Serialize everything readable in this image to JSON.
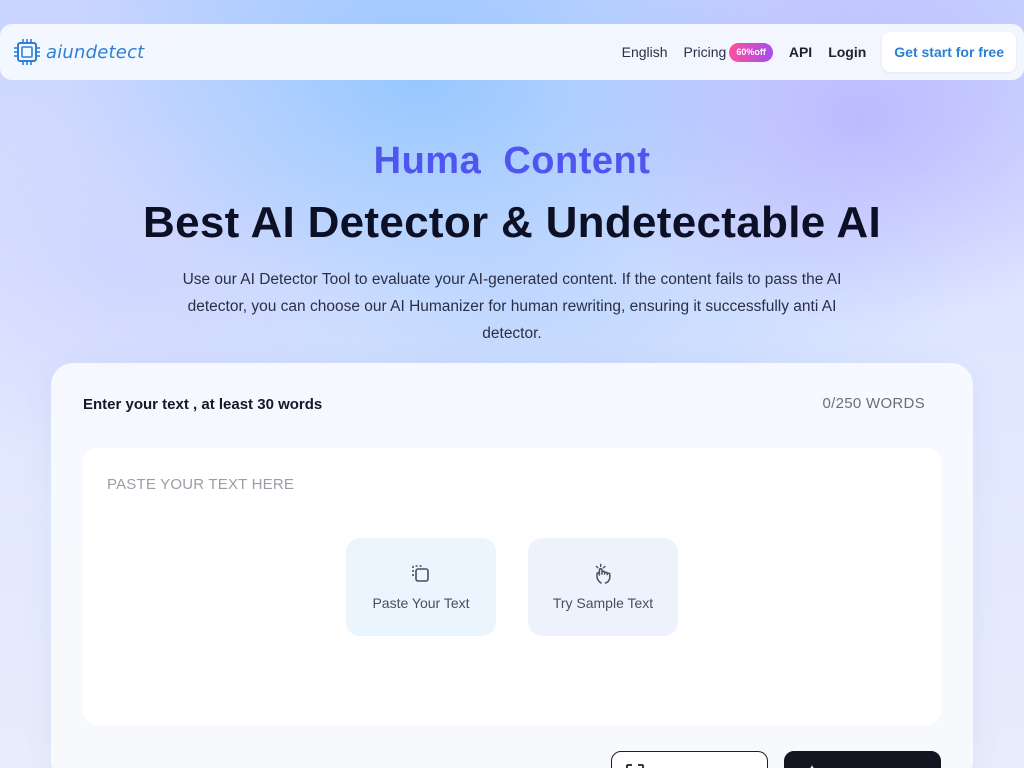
{
  "navbar": {
    "brand_name": "aiundetect",
    "brand_icon": "chip-logo-icon",
    "links": {
      "language": "English",
      "pricing": "Pricing",
      "pricing_badge": "60%off",
      "api": "API",
      "login": "Login"
    },
    "cta_label": "Get start for free"
  },
  "hero": {
    "accent_text": "Huma  Content",
    "title": "Best AI Detector & Undetectable AI",
    "description": "Use our AI Detector Tool to evaluate your AI-generated content. If the content fails to pass the AI detector, you can choose our AI Humanizer for human rewriting, ensuring it successfully anti AI detector."
  },
  "editor": {
    "label": "Enter your text , at least 30 words",
    "word_count": "0/250 WORDS",
    "placeholder": "PASTE YOUR TEXT HERE",
    "actions": [
      {
        "label": "Paste Your Text",
        "icon": "paste-icon"
      },
      {
        "label": "Try Sample Text",
        "icon": "hand-pointer-icon"
      }
    ]
  },
  "colors": {
    "accent": "#4f55ee",
    "brand": "#2f7fd8",
    "badge_gradient": [
      "#ff4fa0",
      "#a34ef0"
    ],
    "dark_button": "#141521"
  }
}
